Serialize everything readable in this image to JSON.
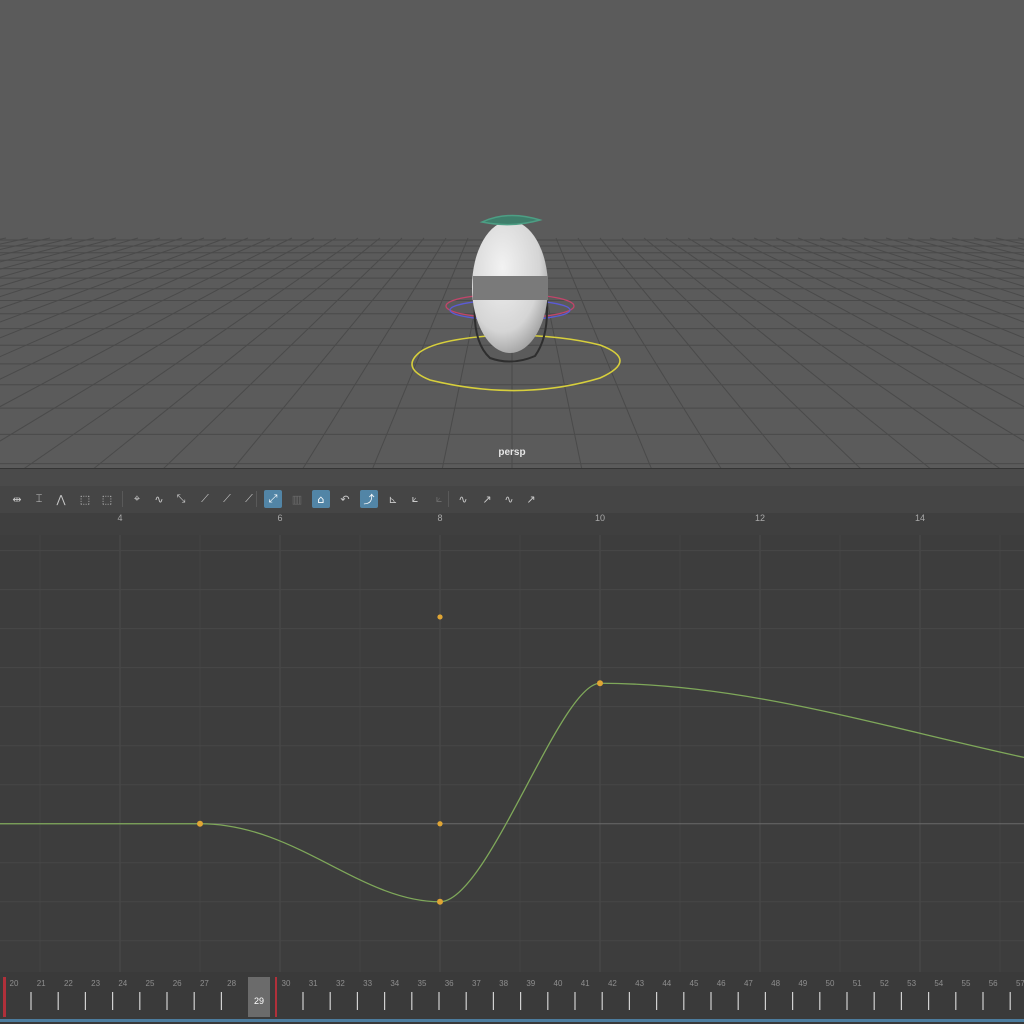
{
  "viewport": {
    "camera_name": "persp",
    "colors": {
      "background": "#5b5b5b",
      "grid": "#4a4a4a",
      "control_ring": "#d7cf3c",
      "rotate_ring_red": "#c3456a",
      "rotate_ring_blue": "#5b5bd6",
      "head_control": "#4d9e84"
    }
  },
  "toolbar": {
    "icons": [
      {
        "name": "move-key-icon",
        "glyph": "⇹",
        "active": false
      },
      {
        "name": "insert-key-icon",
        "glyph": "⌶",
        "active": false
      },
      {
        "name": "lattice-deform-icon",
        "glyph": "⋀",
        "active": false
      },
      {
        "name": "region-scale-icon",
        "glyph": "⬚",
        "active": false
      },
      {
        "name": "retime-icon",
        "glyph": "⬚",
        "active": false
      },
      {
        "name": "tangent-auto-icon",
        "glyph": "⌖",
        "active": false
      },
      {
        "name": "tangent-spline-icon",
        "glyph": "∿",
        "active": false
      },
      {
        "name": "tangent-clamped-icon",
        "glyph": "⤡",
        "active": false
      },
      {
        "name": "tangent-linear-icon",
        "glyph": "⟋",
        "active": false
      },
      {
        "name": "tangent-flat-icon",
        "glyph": "⟋",
        "active": false
      },
      {
        "name": "tangent-step-icon",
        "glyph": "⟋",
        "active": false
      },
      {
        "name": "tangent-plateau-icon",
        "glyph": "⤢",
        "active": true
      },
      {
        "name": "break-tangents-icon",
        "glyph": "▥",
        "active": false,
        "dim": true
      },
      {
        "name": "unify-tangents-icon",
        "glyph": "⌂",
        "active": true
      },
      {
        "name": "weighted-tangents-icon",
        "glyph": "↶",
        "active": false
      },
      {
        "name": "lock-weights-icon",
        "glyph": "⤴",
        "active": true
      },
      {
        "name": "free-weights-icon",
        "glyph": "⊾",
        "active": false
      },
      {
        "name": "normalize-icon",
        "glyph": "⟀",
        "active": false
      },
      {
        "name": "denormalize-icon",
        "glyph": "⟀",
        "active": false,
        "dim": true
      },
      {
        "name": "pre-infinity-cycle-icon",
        "glyph": "∿",
        "active": false
      },
      {
        "name": "post-infinity-cycle-icon",
        "glyph": "↗",
        "active": false
      },
      {
        "name": "cycle-offset-icon",
        "glyph": "∿",
        "active": false
      },
      {
        "name": "oscillate-icon",
        "glyph": "↗",
        "active": false
      }
    ]
  },
  "frame_ruler": {
    "labels": [
      "4",
      "6",
      "8",
      "10",
      "12",
      "14"
    ]
  },
  "graph_editor": {
    "colors": {
      "background": "#3d3d3d",
      "grid": "#484848",
      "curve": "#7fa85a",
      "key": "#e0a534",
      "zero_line": "#6a6a6a"
    }
  },
  "chart_data": {
    "type": "line",
    "xlim": [
      2.5,
      15.3
    ],
    "ylim": [
      -3.8,
      7.4
    ],
    "series": [
      {
        "keys": [
          {
            "x": 5.0,
            "y": 0
          },
          {
            "x": 8.0,
            "y": -2.0
          },
          {
            "x": 10.0,
            "y": 3.6
          }
        ],
        "tangent_handles": [
          {
            "x": 8.0,
            "y": 5.3
          },
          {
            "x": 8.0,
            "y": 0
          }
        ],
        "curve_end": {
          "x": 15.3,
          "y": 1.7
        }
      }
    ]
  },
  "time_slider": {
    "labels": [
      "20",
      "21",
      "22",
      "23",
      "24",
      "25",
      "26",
      "27",
      "28",
      "29",
      "30",
      "31",
      "32",
      "33",
      "34",
      "35",
      "36",
      "37",
      "38",
      "39",
      "40",
      "41",
      "42",
      "43",
      "44",
      "45",
      "46",
      "47",
      "48",
      "49",
      "50",
      "51",
      "52",
      "53",
      "54",
      "55",
      "56",
      "57"
    ],
    "current_frame": "29"
  }
}
